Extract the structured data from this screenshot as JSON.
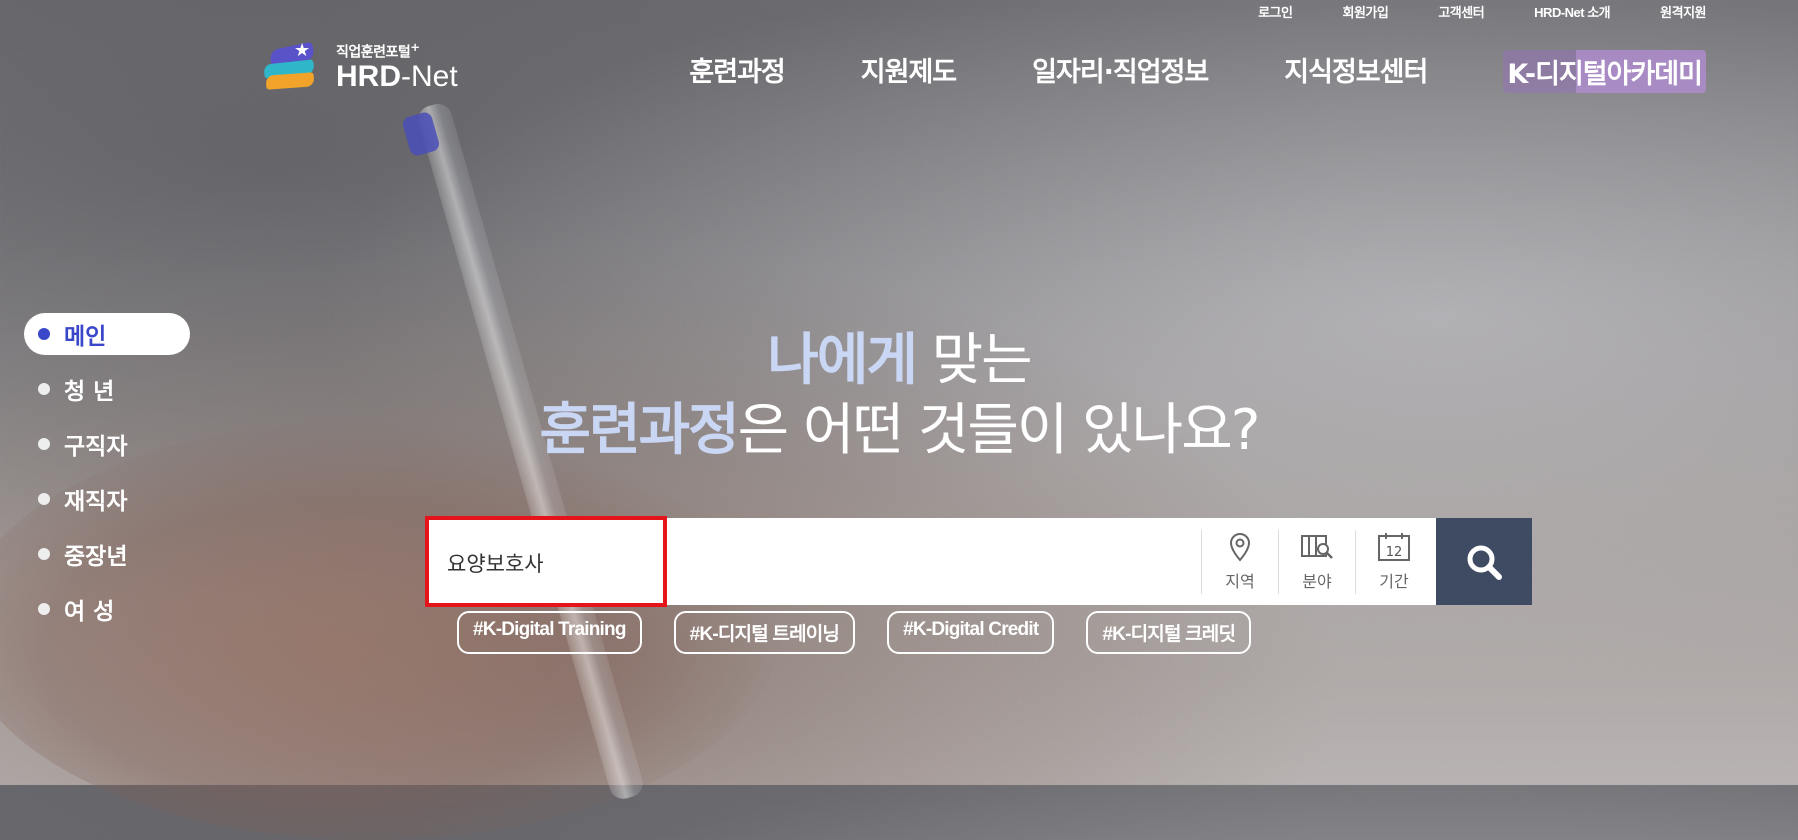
{
  "utility_links": [
    "로그인",
    "회원가입",
    "고객센터",
    "HRD-Net 소개",
    "원격지원"
  ],
  "logo": {
    "subtitle": "직업훈련포털",
    "plus": "+",
    "main_bold": "HRD",
    "main_rest": "-Net"
  },
  "nav": [
    "훈련과정",
    "지원제도",
    "일자리·직업정보",
    "지식정보센터",
    "K-디지털아카데미"
  ],
  "side_menu": [
    {
      "label": "메인",
      "active": true
    },
    {
      "label": "청 년",
      "active": false
    },
    {
      "label": "구직자",
      "active": false
    },
    {
      "label": "재직자",
      "active": false
    },
    {
      "label": "중장년",
      "active": false
    },
    {
      "label": "여 성",
      "active": false
    }
  ],
  "headline": {
    "line1_em": "나에게",
    "line1_rest": " 맞는",
    "line2_em": "훈련과정",
    "line2_rest": "은 어떤 것들이 있나요?"
  },
  "search": {
    "value": "요양보호사",
    "filters": [
      {
        "label": "지역",
        "icon": "location-pin-icon"
      },
      {
        "label": "분야",
        "icon": "field-search-icon"
      },
      {
        "label": "기간",
        "icon": "calendar-icon",
        "icon_text": "12"
      }
    ],
    "button_icon": "search-icon"
  },
  "hashtags": [
    "#K-Digital Training",
    "#K-디지털 트레이닝",
    "#K-Digital Credit",
    "#K-디지털 크레딧"
  ],
  "colors": {
    "highlight_box": "#e5131a",
    "search_button": "#3f4a63",
    "active_side": "#3a47c9",
    "headline_em": "#c9d6f4"
  }
}
